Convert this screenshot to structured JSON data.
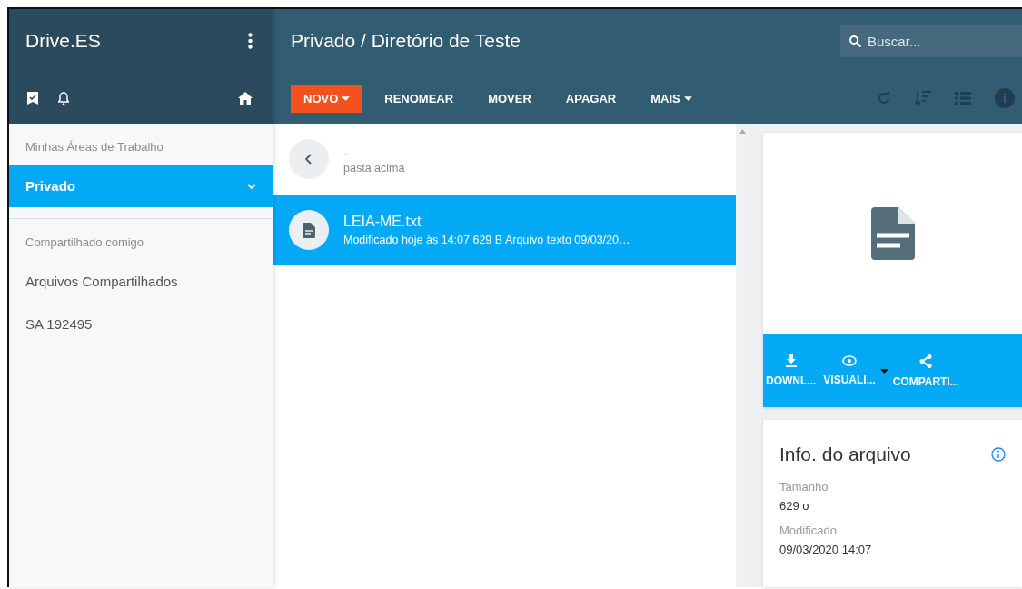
{
  "app": {
    "title": "Drive.ES"
  },
  "header": {
    "path": "Privado / Diretório de Teste",
    "search": {
      "placeholder": "Buscar..."
    }
  },
  "toolbar": [
    {
      "label": "NOVO",
      "kind": "primary",
      "dropdown": true
    },
    {
      "label": "RENOMEAR",
      "kind": "plain",
      "dropdown": false
    },
    {
      "label": "MOVER",
      "kind": "plain",
      "dropdown": false
    },
    {
      "label": "APAGAR",
      "kind": "plain",
      "dropdown": false
    },
    {
      "label": "MAIS",
      "kind": "plain",
      "dropdown": true
    }
  ],
  "sidebar": {
    "items": [
      {
        "kind": "header",
        "label": "Minhas Áreas de Trabalho"
      },
      {
        "kind": "item",
        "label": "Privado",
        "selected": true,
        "expanded": false
      },
      {
        "kind": "divider"
      },
      {
        "kind": "header",
        "label": "Compartilhado comigo"
      },
      {
        "kind": "item",
        "label": "Arquivos Compartilhados",
        "selected": false
      },
      {
        "kind": "item",
        "label": "SA 192495",
        "selected": false
      }
    ]
  },
  "files": [
    {
      "kind": "parent",
      "name": "..",
      "detail": "pasta acima",
      "selected": false
    },
    {
      "kind": "file",
      "name": "LEIA-ME.txt",
      "detail": "Modificado hoje às 14:07  629 B  Arquivo texto  09/03/20…",
      "selected": true
    }
  ],
  "preview": {
    "actions": [
      {
        "label": "DOWNL...",
        "kind": "download"
      },
      {
        "label": "VISUALI...",
        "kind": "view"
      },
      {
        "label": "COMPARTI...",
        "kind": "share"
      }
    ]
  },
  "info": {
    "title": "Info. do arquivo",
    "fields": [
      {
        "label": "Tamanho",
        "value": "629 o"
      },
      {
        "label": "Modificado",
        "value": "09/03/2020 14:07"
      }
    ]
  }
}
